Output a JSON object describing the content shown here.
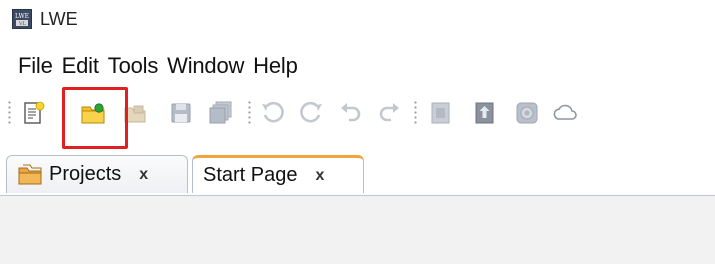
{
  "window": {
    "title": "LWE",
    "logo_text_top": "LWE",
    "logo_text_bottom": "VL"
  },
  "menu": [
    "File",
    "Edit",
    "Tools",
    "Window",
    "Help"
  ],
  "toolbar": {
    "buttons": [
      {
        "name": "new-file-icon",
        "enabled": true
      },
      {
        "name": "new-project-icon",
        "enabled": true,
        "highlighted": true
      },
      {
        "name": "open-project-icon",
        "enabled": false
      },
      {
        "name": "save-icon",
        "enabled": false
      },
      {
        "name": "save-all-icon",
        "enabled": false
      },
      {
        "name": "rotate-ccw-icon",
        "enabled": false
      },
      {
        "name": "rotate-cw-icon",
        "enabled": false
      },
      {
        "name": "undo-icon",
        "enabled": false
      },
      {
        "name": "redo-icon",
        "enabled": false
      },
      {
        "name": "import-icon",
        "enabled": false
      },
      {
        "name": "export-icon",
        "enabled": false
      },
      {
        "name": "settings-icon",
        "enabled": false
      },
      {
        "name": "cloud-icon",
        "enabled": false
      }
    ],
    "highlight_color": "#e02020"
  },
  "tabs": [
    {
      "label": "Projects",
      "close": "x",
      "active": false
    },
    {
      "label": "Start Page",
      "close": "x",
      "active": true
    }
  ],
  "colors": {
    "active_tab_accent": "#f0a63a",
    "panel_background": "#f2f2f2"
  }
}
